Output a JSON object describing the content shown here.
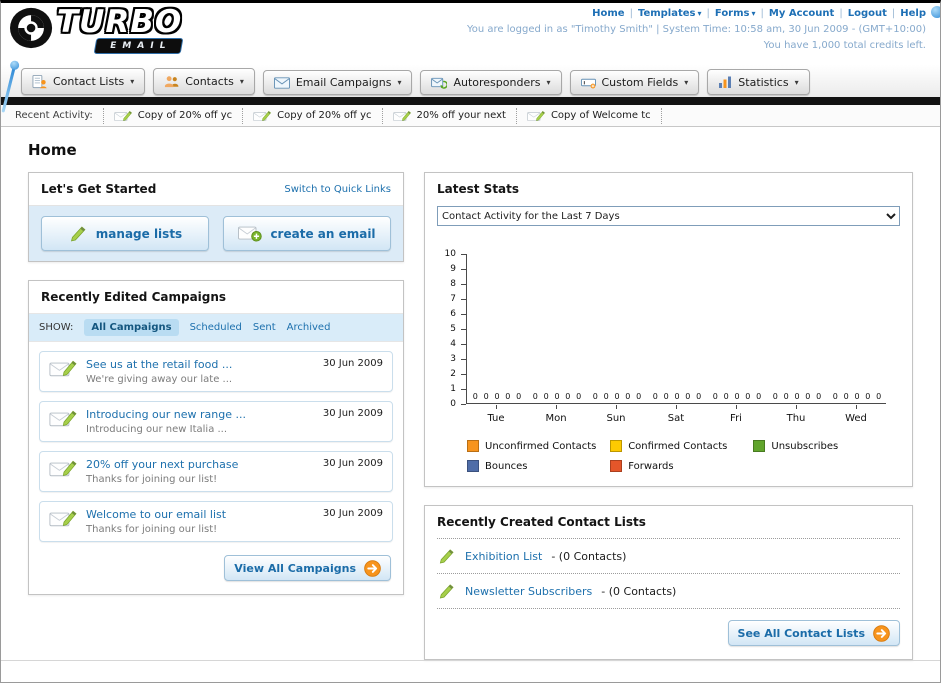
{
  "header": {
    "logo_title": "TURBO",
    "logo_subtitle": "EMAIL",
    "links": [
      {
        "label": "Home",
        "dropdown": false
      },
      {
        "label": "Templates",
        "dropdown": true
      },
      {
        "label": "Forms",
        "dropdown": true
      },
      {
        "label": "My Account",
        "dropdown": false
      },
      {
        "label": "Logout",
        "dropdown": false
      },
      {
        "label": "Help",
        "dropdown": false
      }
    ],
    "session_line": "You are logged in as \"Timothy Smith\" | System Time: 10:58 am, 30 Jun 2009 - (GMT+10:00)",
    "credits_line": "You have 1,000 total credits left."
  },
  "nav": {
    "items": [
      {
        "label": "Contact Lists",
        "icon": "contact-lists-icon"
      },
      {
        "label": "Contacts",
        "icon": "contacts-icon"
      },
      {
        "label": "Email Campaigns",
        "icon": "email-campaigns-icon"
      },
      {
        "label": "Autoresponders",
        "icon": "autoresponders-icon"
      },
      {
        "label": "Custom Fields",
        "icon": "custom-fields-icon"
      },
      {
        "label": "Statistics",
        "icon": "statistics-icon"
      }
    ]
  },
  "recent_activity": {
    "label": "Recent Activity:",
    "items": [
      {
        "text": "Copy of 20% off yc"
      },
      {
        "text": "Copy of 20% off yc"
      },
      {
        "text": "20% off your next"
      },
      {
        "text": "Copy of Welcome tc"
      }
    ]
  },
  "page": {
    "title": "Home"
  },
  "get_started": {
    "title": "Let's Get Started",
    "switch_link": "Switch to Quick Links",
    "manage_lists_label": "manage lists",
    "create_email_label": "create an email"
  },
  "campaigns": {
    "title": "Recently Edited Campaigns",
    "show_label": "SHOW:",
    "tabs": [
      {
        "label": "All Campaigns",
        "active": true
      },
      {
        "label": "Scheduled",
        "active": false
      },
      {
        "label": "Sent",
        "active": false
      },
      {
        "label": "Archived",
        "active": false
      }
    ],
    "items": [
      {
        "title": "See us at the retail food ...",
        "subtitle": "We're giving away our late ...",
        "date": "30 Jun 2009"
      },
      {
        "title": "Introducing our new range ...",
        "subtitle": "Introducing our new Italia ...",
        "date": "30 Jun 2009"
      },
      {
        "title": "20% off your next purchase",
        "subtitle": "Thanks for joining our list!",
        "date": "30 Jun 2009"
      },
      {
        "title": "Welcome to our email list",
        "subtitle": "Thanks for joining our list!",
        "date": "30 Jun 2009"
      }
    ],
    "view_all_label": "View All Campaigns"
  },
  "stats": {
    "title": "Latest Stats",
    "selected_option": "Contact Activity for the Last 7 Days"
  },
  "chart_data": {
    "type": "bar",
    "title": "Contact Activity for the Last 7 Days",
    "categories": [
      "Tue",
      "Mon",
      "Sun",
      "Sat",
      "Fri",
      "Thu",
      "Wed"
    ],
    "series": [
      {
        "name": "Unconfirmed Contacts",
        "color": "#f7941d",
        "values": [
          0,
          0,
          0,
          0,
          0,
          0,
          0
        ]
      },
      {
        "name": "Confirmed Contacts",
        "color": "#fdca01",
        "values": [
          0,
          0,
          0,
          0,
          0,
          0,
          0
        ]
      },
      {
        "name": "Unsubscribes",
        "color": "#61a52c",
        "values": [
          0,
          0,
          0,
          0,
          0,
          0,
          0
        ]
      },
      {
        "name": "Bounces",
        "color": "#4f6da8",
        "values": [
          0,
          0,
          0,
          0,
          0,
          0,
          0
        ]
      },
      {
        "name": "Forwards",
        "color": "#e5562a",
        "values": [
          0,
          0,
          0,
          0,
          0,
          0,
          0
        ]
      }
    ],
    "xlabel": "",
    "ylabel": "",
    "ylim": [
      0,
      10
    ],
    "yticks": [
      0,
      1,
      2,
      3,
      4,
      5,
      6,
      7,
      8,
      9,
      10
    ],
    "grid": false,
    "legend_position": "bottom"
  },
  "contact_lists": {
    "title": "Recently Created Contact Lists",
    "items": [
      {
        "name": "Exhibition List",
        "count_text": "- (0 Contacts)"
      },
      {
        "name": "Newsletter Subscribers",
        "count_text": "- (0 Contacts)"
      }
    ],
    "see_all_label": "See All Contact Lists"
  },
  "colors": {
    "link_blue": "#1d70ad",
    "accent_orange": "#f7941d"
  }
}
